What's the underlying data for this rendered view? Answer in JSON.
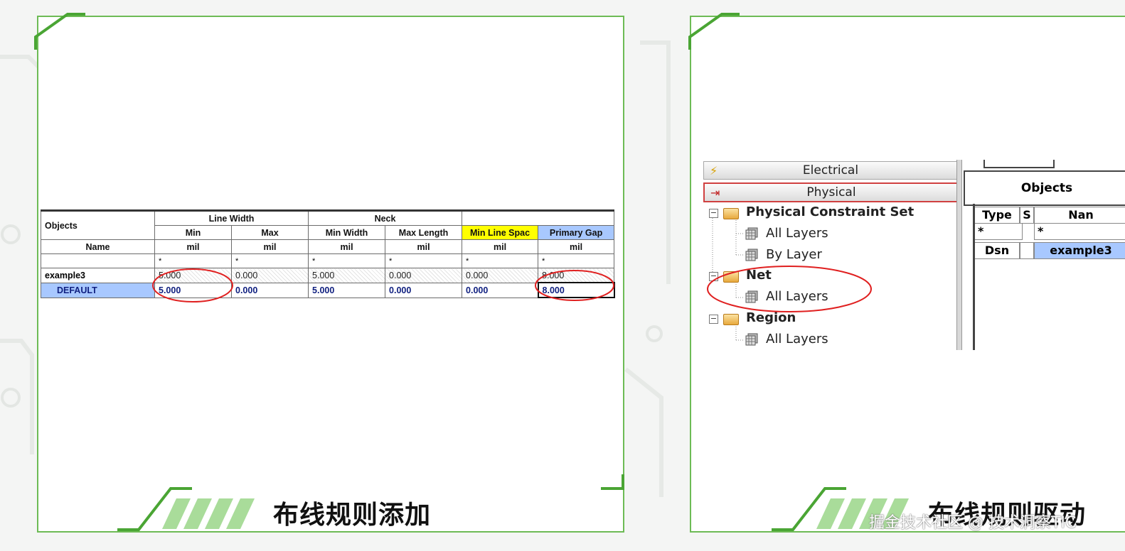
{
  "left_panel": {
    "headers": {
      "objects": "Objects",
      "line_width": "Line Width",
      "neck": "Neck",
      "min": "Min",
      "max": "Max",
      "min_width": "Min Width",
      "max_length": "Max Length",
      "min_line_spac": "Min Line Spac",
      "primary_gap": "Primary Gap",
      "name": "Name",
      "unit": "mil"
    },
    "filter_star": "*",
    "rows": [
      {
        "name": "example3",
        "values": [
          "5.000",
          "0.000",
          "5.000",
          "0.000",
          "0.000",
          "8.000"
        ]
      },
      {
        "name": "DEFAULT",
        "values": [
          "5.000",
          "0.000",
          "5.000",
          "0.000",
          "0.000",
          "8.000"
        ]
      }
    ],
    "caption": "布线规则添加"
  },
  "right_panel": {
    "worksheets": [
      {
        "label": "Electrical",
        "icon": "lightning-icon"
      },
      {
        "label": "Physical",
        "icon": "physical-icon"
      }
    ],
    "tree": [
      {
        "label": "Physical Constraint Set",
        "type": "folder"
      },
      {
        "label": "All Layers",
        "type": "layers"
      },
      {
        "label": "By Layer",
        "type": "layers"
      },
      {
        "label": "Net",
        "type": "folder"
      },
      {
        "label": "All Layers",
        "type": "layers"
      },
      {
        "label": "Region",
        "type": "folder"
      },
      {
        "label": "All Layers",
        "type": "layers"
      }
    ],
    "objects_header": "Objects",
    "col_type": "Type",
    "col_s": "S",
    "col_name": "Nan",
    "star": "*",
    "row_type": "Dsn",
    "row_name": "example3",
    "caption": "布线规则驱动",
    "colors": {
      "accent": "#6dbb55",
      "highlight_circle": "#e02020",
      "selected": "#a8c8ff"
    }
  },
  "watermark": "掘金技术社区 @ 技术洞察TIC"
}
